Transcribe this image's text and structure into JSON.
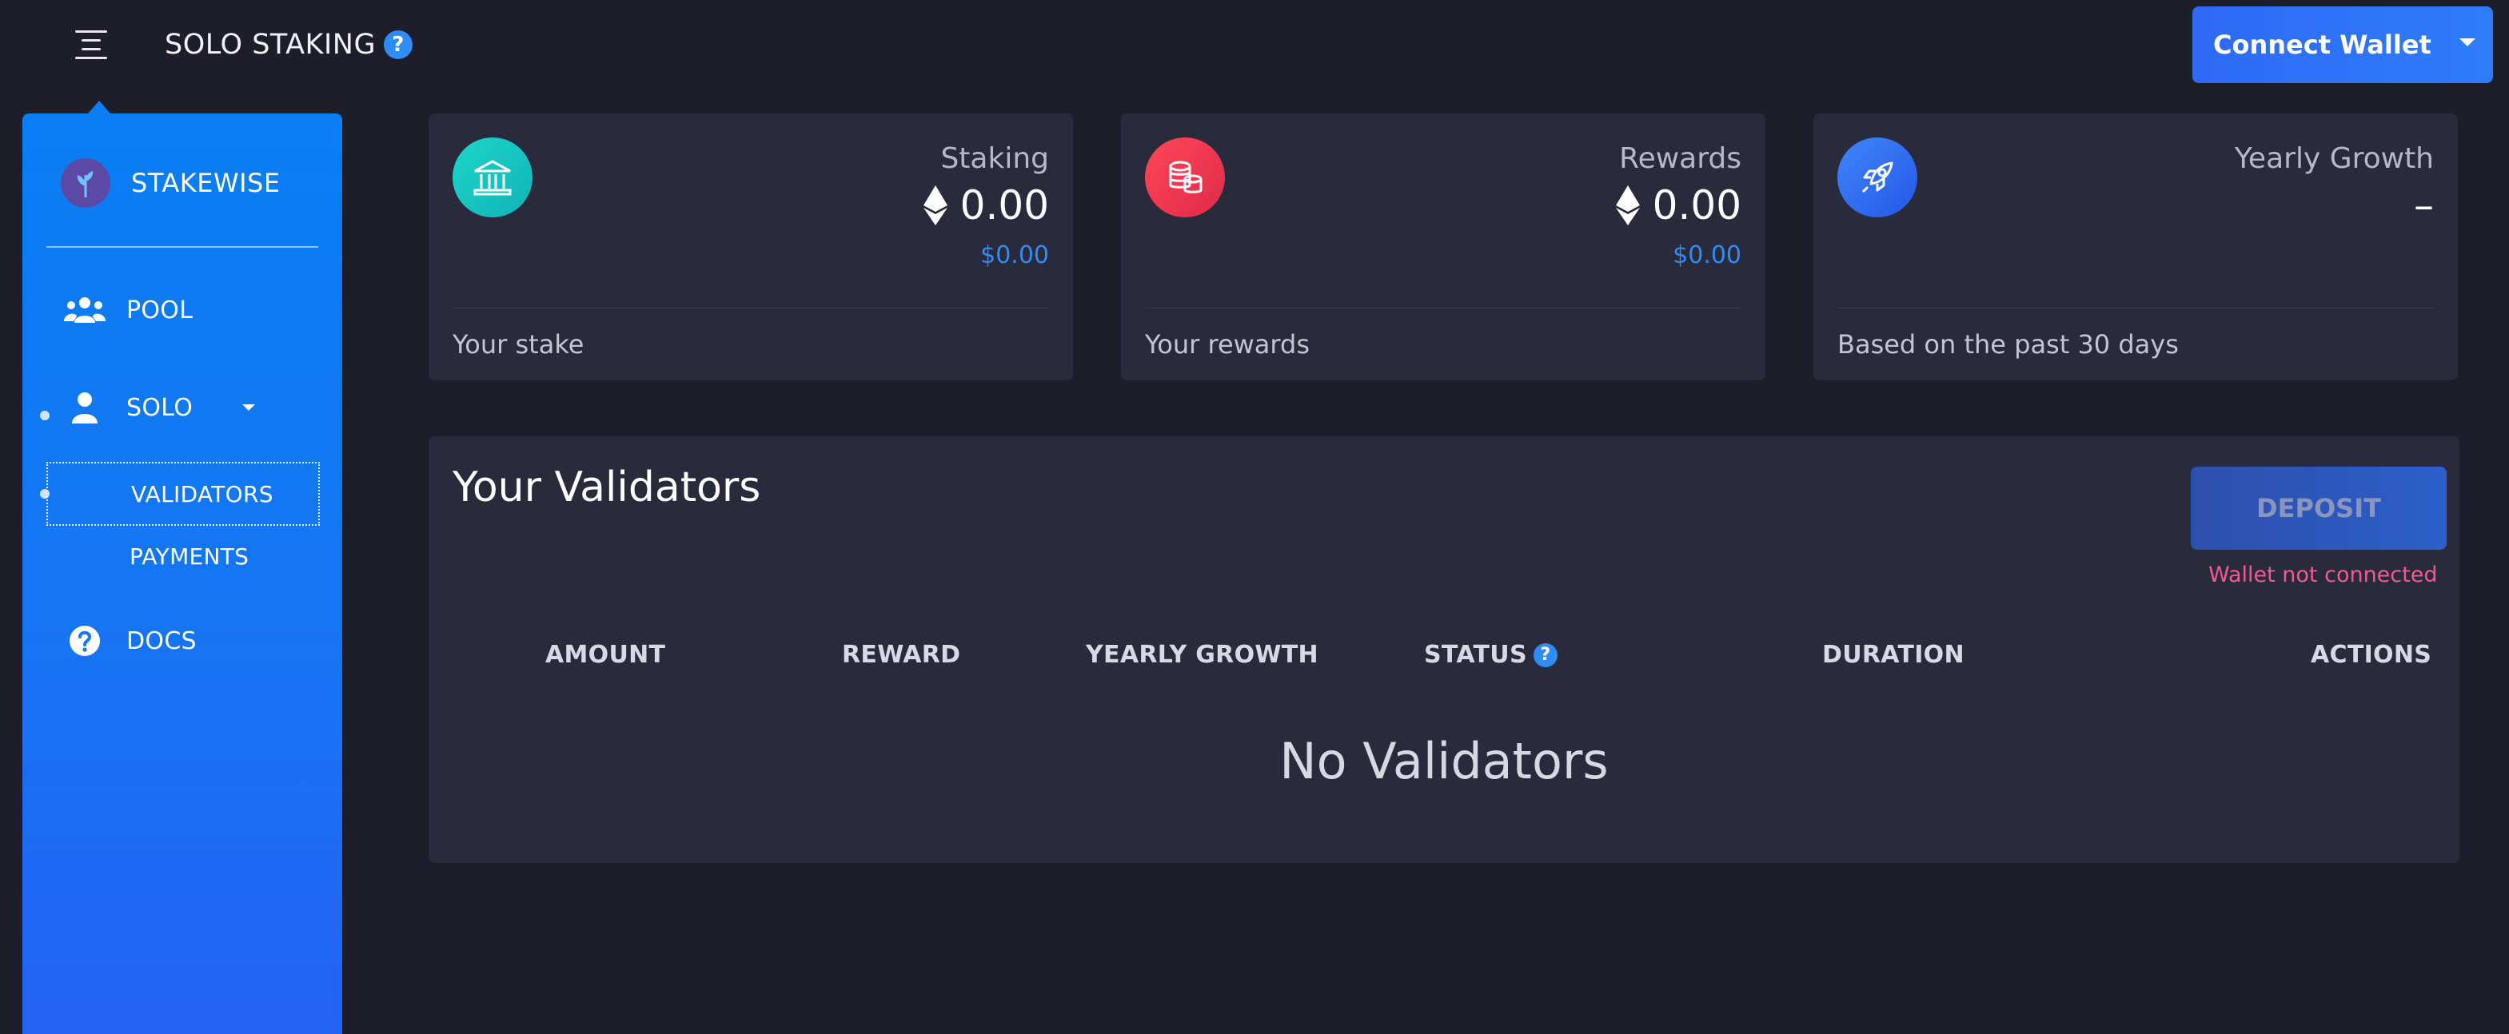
{
  "header": {
    "title": "SOLO STAKING",
    "help_glyph": "?",
    "connect_label": "Connect Wallet"
  },
  "sidebar": {
    "brand": "STAKEWISE",
    "items": [
      {
        "label": "POOL",
        "icon": "users-icon"
      },
      {
        "label": "SOLO",
        "icon": "user-icon"
      },
      {
        "label": "DOCS",
        "icon": "help-circle-icon"
      }
    ],
    "sub_items": [
      {
        "label": "VALIDATORS"
      },
      {
        "label": "PAYMENTS"
      }
    ]
  },
  "stats": [
    {
      "label": "Staking",
      "value": "0.00",
      "usd": "$0.00",
      "footer": "Your stake",
      "icon": "bank-icon",
      "color": "#13c6c0"
    },
    {
      "label": "Rewards",
      "value": "0.00",
      "usd": "$0.00",
      "footer": "Your rewards",
      "icon": "coins-icon",
      "color": "#f0344f"
    },
    {
      "label": "Yearly Growth",
      "value": "–",
      "footer": "Based on the past 30 days",
      "icon": "rocket-icon",
      "color": "#2f6ff0"
    }
  ],
  "validators": {
    "title": "Your Validators",
    "deposit_label": "DEPOSIT",
    "warning": "Wallet not connected",
    "columns": [
      "AMOUNT",
      "REWARD",
      "YEARLY GROWTH",
      "STATUS",
      "DURATION",
      "ACTIONS"
    ],
    "empty_text": "No Validators"
  },
  "colors": {
    "accent": "#2f8cf4",
    "background": "#1e1e2a",
    "card": "#292b3d",
    "warning": "#f05a91"
  }
}
